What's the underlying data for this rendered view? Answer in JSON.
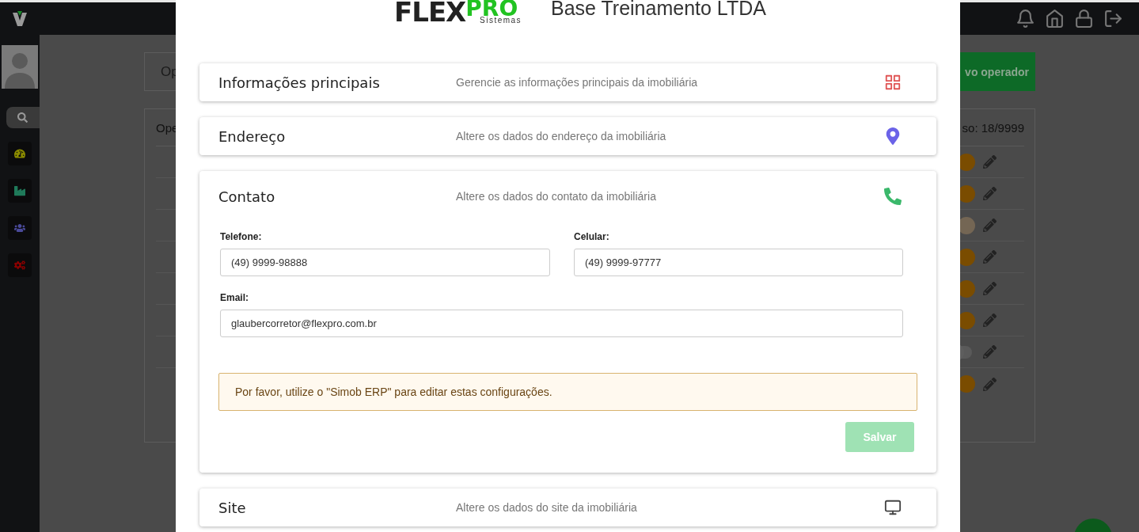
{
  "background": {
    "page_header": "Op",
    "new_button": "vo operador",
    "list_title": "Ope",
    "list_counter": "so: 18/9999",
    "rows": [
      {
        "on": true,
        "disabled": false
      },
      {
        "on": true,
        "disabled": false
      },
      {
        "on": true,
        "disabled": true
      },
      {
        "on": true,
        "disabled": false
      },
      {
        "on": true,
        "disabled": false
      },
      {
        "on": true,
        "disabled": false
      },
      {
        "on": false,
        "disabled": false
      },
      {
        "on": true,
        "disabled": false
      }
    ]
  },
  "modal": {
    "logo": {
      "word_1": "FLEX",
      "word_2": "PRO",
      "tagline": "Sistemas"
    },
    "company": "Base Treinamento LTDA",
    "sections": [
      {
        "title": "Informações principais",
        "description": "Gerencie as informações principais da imobiliária",
        "expanded": false
      },
      {
        "title": "Endereço",
        "description": "Altere os dados do endereço da imobiliária",
        "expanded": false
      },
      {
        "title": "Contato",
        "description": "Altere os dados do contato da imobiliária",
        "expanded": true,
        "fields": [
          {
            "label": "Telefone:",
            "value": "(49) 9999-98888"
          },
          {
            "label": "Celular:",
            "value": "(49) 9999-97777"
          },
          {
            "label": "Email:",
            "value": "glaubercorretor@flexpro.com.br"
          }
        ],
        "alert": "Por favor, utilize o \"Simob ERP\" para editar estas configurações.",
        "save_button": {
          "label": "Salvar",
          "disabled": true
        }
      },
      {
        "title": "Site",
        "description": "Altere os dados do site da imobiliária",
        "expanded": false
      }
    ]
  }
}
